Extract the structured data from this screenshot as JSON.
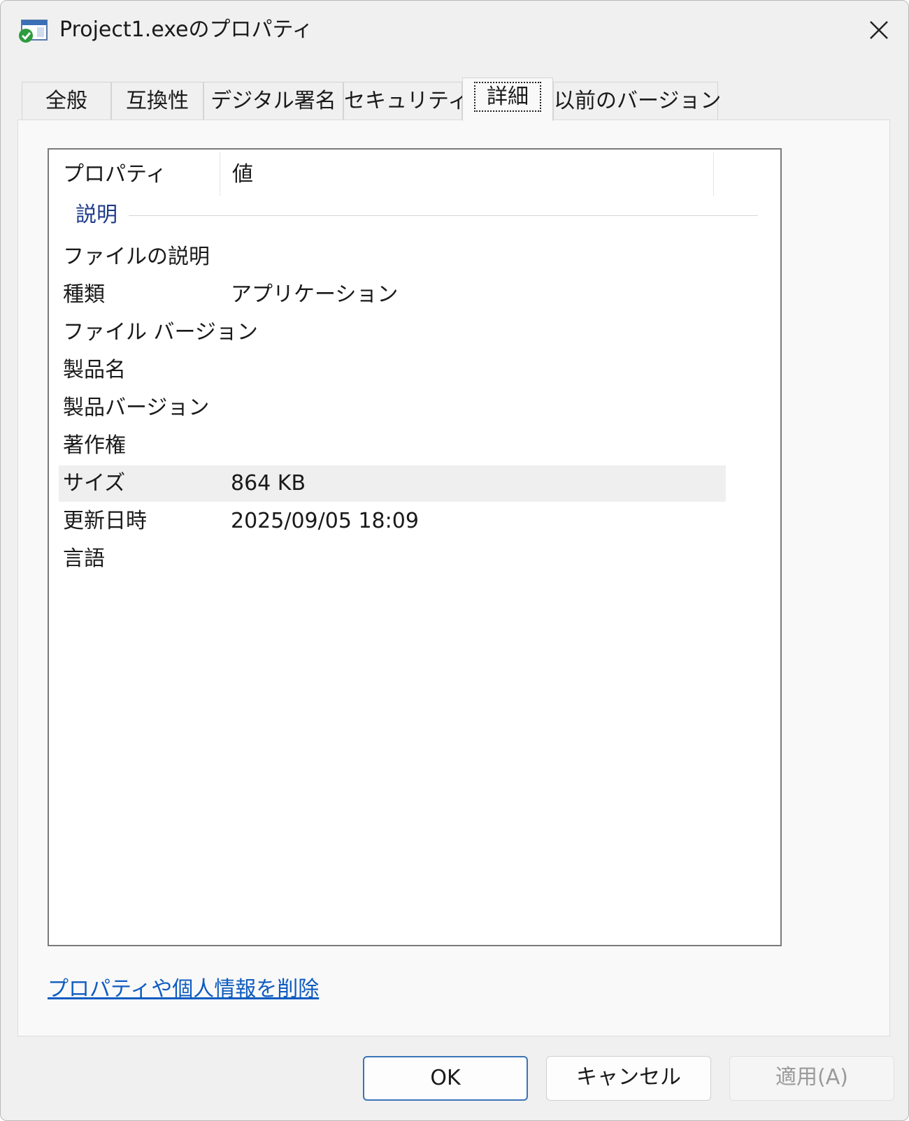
{
  "window": {
    "title": "Project1.exeのプロパティ"
  },
  "tabs": [
    {
      "label": "全般"
    },
    {
      "label": "互換性"
    },
    {
      "label": "デジタル署名"
    },
    {
      "label": "セキュリティ"
    },
    {
      "label": "詳細",
      "active": true
    },
    {
      "label": "以前のバージョン"
    }
  ],
  "details": {
    "col_property": "プロパティ",
    "col_value": "値",
    "group": "説明",
    "rows": [
      {
        "property": "ファイルの説明",
        "value": ""
      },
      {
        "property": "種類",
        "value": "アプリケーション"
      },
      {
        "property": "ファイル バージョン",
        "value": ""
      },
      {
        "property": "製品名",
        "value": ""
      },
      {
        "property": "製品バージョン",
        "value": ""
      },
      {
        "property": "著作権",
        "value": ""
      },
      {
        "property": "サイズ",
        "value": "864 KB"
      },
      {
        "property": "更新日時",
        "value": "2025/09/05 18:09"
      },
      {
        "property": "言語",
        "value": ""
      }
    ]
  },
  "remove_link": "プロパティや個人情報を削除",
  "buttons": {
    "ok": "OK",
    "cancel": "キャンセル",
    "apply": "適用(A)"
  },
  "colors": {
    "link": "#0f5cc0",
    "group_label": "#1e3a8a",
    "primary_border": "#3b74b8"
  }
}
